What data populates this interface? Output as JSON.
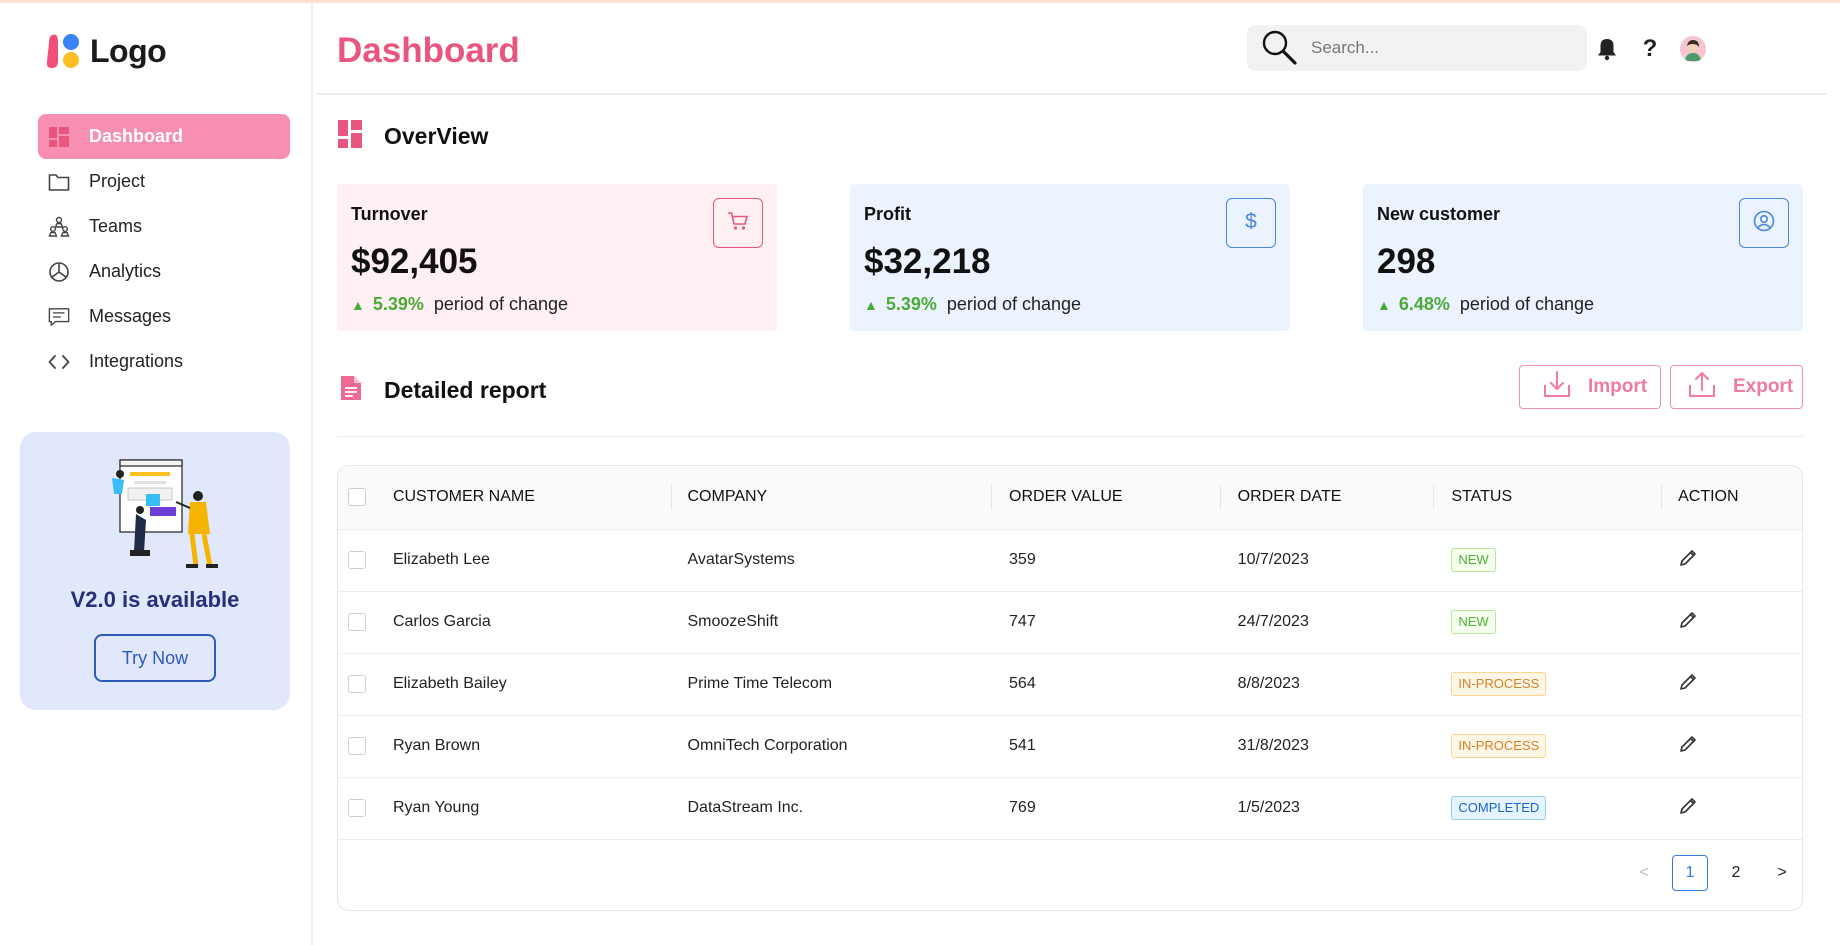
{
  "app": {
    "logo_text": "Logo"
  },
  "sidebar": {
    "items": [
      {
        "label": "Dashboard",
        "icon": "dashboard-icon",
        "active": true
      },
      {
        "label": "Project",
        "icon": "folder-icon",
        "active": false
      },
      {
        "label": "Teams",
        "icon": "teams-icon",
        "active": false
      },
      {
        "label": "Analytics",
        "icon": "analytics-icon",
        "active": false
      },
      {
        "label": "Messages",
        "icon": "messages-icon",
        "active": false
      },
      {
        "label": "Integrations",
        "icon": "code-icon",
        "active": false
      }
    ],
    "promo": {
      "title": "V2.0 is available",
      "button_label": "Try Now"
    }
  },
  "header": {
    "title": "Dashboard",
    "search_placeholder": "Search...",
    "help_label": "?"
  },
  "overview": {
    "title": "OverView",
    "cards": [
      {
        "title": "Turnover",
        "value": "$92,405",
        "change": "5.39%",
        "change_desc": "period of change",
        "icon": "cart-icon",
        "tone": "pink"
      },
      {
        "title": "Profit",
        "value": "$32,218",
        "change": "5.39%",
        "change_desc": "period of change",
        "icon": "dollar-icon",
        "tone": "blue"
      },
      {
        "title": "New customer",
        "value": "298",
        "change": "6.48%",
        "change_desc": "period of change",
        "icon": "user-circle-icon",
        "tone": "blue"
      }
    ]
  },
  "report": {
    "title": "Detailed report",
    "import_label": "Import",
    "export_label": "Export",
    "columns": [
      "CUSTOMER NAME",
      "COMPANY",
      "ORDER VALUE",
      "ORDER DATE",
      "STATUS",
      "ACTION"
    ],
    "rows": [
      {
        "name": "Elizabeth Lee",
        "company": "AvatarSystems",
        "value": "359",
        "date": "10/7/2023",
        "status": "NEW",
        "status_type": "new"
      },
      {
        "name": "Carlos Garcia",
        "company": "SmoozeShift",
        "value": "747",
        "date": "24/7/2023",
        "status": "NEW",
        "status_type": "new"
      },
      {
        "name": "Elizabeth Bailey",
        "company": "Prime Time Telecom",
        "value": "564",
        "date": "8/8/2023",
        "status": "IN-PROCESS",
        "status_type": "inprocess"
      },
      {
        "name": "Ryan Brown",
        "company": "OmniTech Corporation",
        "value": "541",
        "date": "31/8/2023",
        "status": "IN-PROCESS",
        "status_type": "inprocess"
      },
      {
        "name": "Ryan Young",
        "company": "DataStream Inc.",
        "value": "769",
        "date": "1/5/2023",
        "status": "COMPLETED",
        "status_type": "completed"
      }
    ],
    "pagination": {
      "prev": "<",
      "pages": [
        "1",
        "2"
      ],
      "current": "1",
      "next": ">"
    }
  },
  "colors": {
    "accent_pink": "#e8557f",
    "active_nav": "#f78fb3",
    "positive": "#4caa38",
    "promo_bg": "#e1e8fb"
  }
}
